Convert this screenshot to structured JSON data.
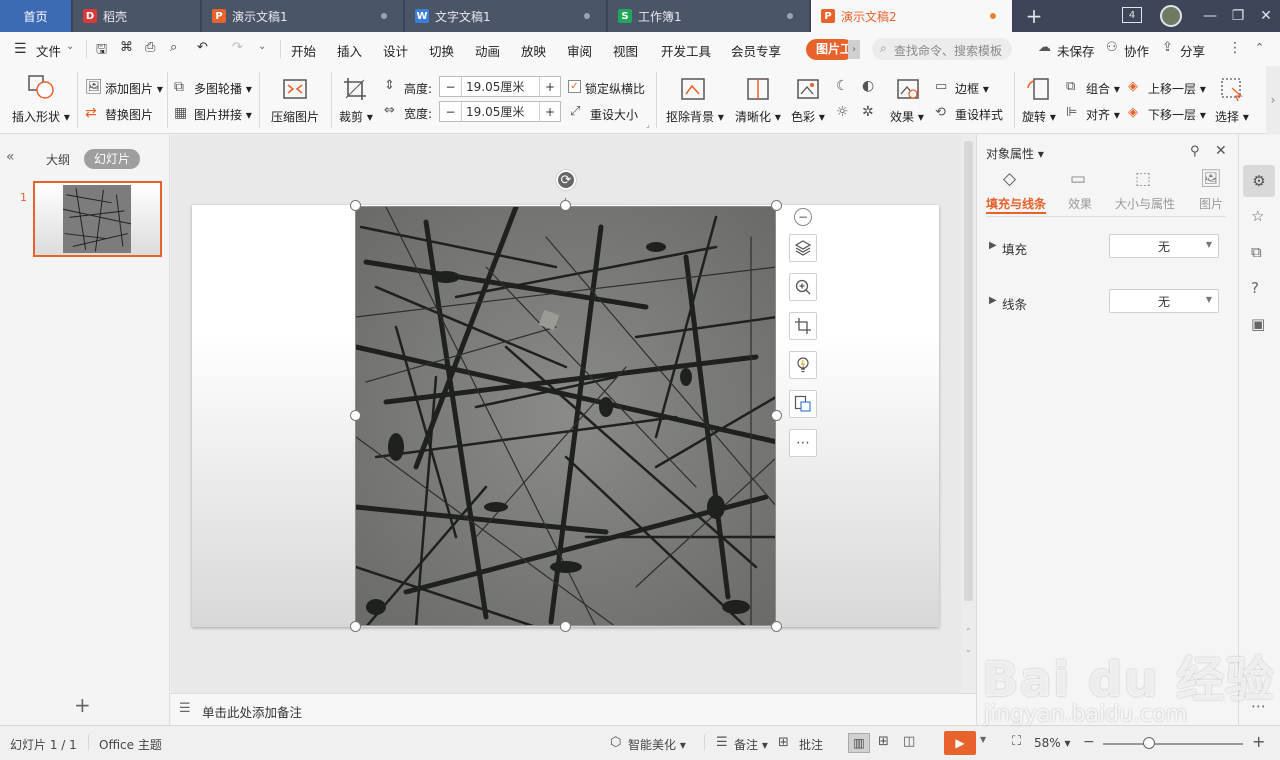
{
  "tabs": [
    {
      "label": "首页"
    },
    {
      "label": "稻壳",
      "icon_letter": "D"
    },
    {
      "label": "演示文稿1",
      "icon_letter": "P"
    },
    {
      "label": "文字文稿1",
      "icon_letter": "W"
    },
    {
      "label": "工作簿1",
      "icon_letter": "S"
    },
    {
      "label": "演示文稿2",
      "icon_letter": "P"
    }
  ],
  "window": {
    "badge": "4"
  },
  "menu": {
    "file": "文件",
    "items": [
      "开始",
      "插入",
      "设计",
      "切换",
      "动画",
      "放映",
      "审阅",
      "视图",
      "开发工具",
      "会员专享"
    ],
    "context_tab": "图片工",
    "search_placeholder": "查找命令、搜索模板",
    "unsaved": "未保存",
    "collab": "协作",
    "share": "分享"
  },
  "ribbon": {
    "insert_shape": "插入形状",
    "add_picture": "添加图片",
    "replace_picture": "替换图片",
    "multi_carousel": "多图轮播",
    "picture_collage": "图片拼接",
    "compress": "压缩图片",
    "crop": "裁剪",
    "height_label": "高度:",
    "width_label": "宽度:",
    "height_value": "19.05厘米",
    "width_value": "19.05厘米",
    "lock_ratio": "锁定纵横比",
    "reset_size": "重设大小",
    "remove_bg": "抠除背景",
    "sharpen": "清晰化",
    "color": "色彩",
    "effect": "效果",
    "border": "边框",
    "reset_style": "重设样式",
    "rotate": "旋转",
    "group": "组合",
    "align": "对齐",
    "bring_forward": "上移一层",
    "send_backward": "下移一层",
    "select": "选择"
  },
  "left_panel": {
    "outline_tab": "大纲",
    "slides_tab": "幻灯片",
    "slide_number": "1"
  },
  "notes": {
    "placeholder": "单击此处添加备注"
  },
  "right_panel": {
    "title": "对象属性",
    "tabs": [
      "填充与线条",
      "效果",
      "大小与属性",
      "图片"
    ],
    "fill_label": "填充",
    "fill_value": "无",
    "line_label": "线条",
    "line_value": "无"
  },
  "status": {
    "slide_info": "幻灯片 1 / 1",
    "theme": "Office 主题",
    "smart_beautify": "智能美化",
    "notes": "备注",
    "comments": "批注",
    "zoom": "58%",
    "zoom_fraction": 0.33
  },
  "watermark": {
    "brand": "Bai du 经验",
    "url": "jingyan.baidu.com"
  },
  "colors": {
    "accent": "#e8622c",
    "tabbar": "#3c4658",
    "home_tab": "#3d6bb3",
    "word_icon": "#3c7fd6",
    "sheet_icon": "#22a65e",
    "ppt_icon": "#e8622c",
    "daoke_icon": "#d83a3a"
  }
}
